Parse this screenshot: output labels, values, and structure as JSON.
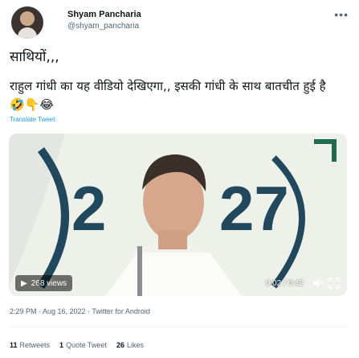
{
  "author": {
    "name": "Shyam Pancharia",
    "handle": "@shyam_pancharia"
  },
  "tweet": {
    "line1": "साथियों,,,",
    "line2": "राहुल गांधी का यह वीडियो देखिएगा,, इसकी गांधी के साथ बातचीत हुई है🤣👇😂",
    "translate_label": "Translate Tweet"
  },
  "video": {
    "views": "268 views",
    "time": "0:02 / 0:42",
    "backdrop_text": "2027",
    "backdrop_color": "#22485e",
    "accent_color": "#1e6b52"
  },
  "meta": {
    "timestamp": "2:29 PM · Aug 16, 2022 · Twitter for Android"
  },
  "stats": {
    "retweets_count": "11",
    "retweets_label": "Retweets",
    "quote_count": "1",
    "quote_label": "Quote Tweet",
    "likes_count": "26",
    "likes_label": "Likes"
  },
  "icons": {
    "more": "more-icon",
    "play": "play-icon",
    "volume": "volume-icon",
    "fullscreen": "fullscreen-icon"
  }
}
